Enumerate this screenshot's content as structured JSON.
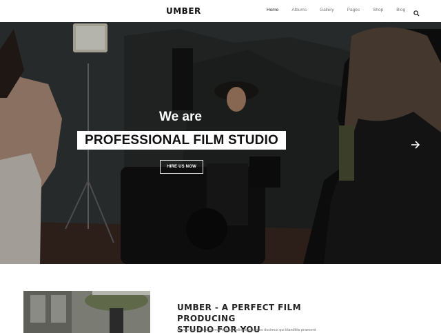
{
  "header": {
    "logo": "UMBER",
    "nav": [
      {
        "label": "Home",
        "active": true
      },
      {
        "label": "Albums",
        "active": false
      },
      {
        "label": "Gallery",
        "active": false
      },
      {
        "label": "Pages",
        "active": false
      },
      {
        "label": "Shop",
        "active": false
      },
      {
        "label": "Blog",
        "active": false
      }
    ],
    "search_icon": "search-icon"
  },
  "hero": {
    "kicker": "We are",
    "title": "PROFESSIONAL FILM STUDIO",
    "button_label": "HIRE US NOW",
    "next_icon": "arrow-right-icon"
  },
  "intro": {
    "title_line1": "UMBER - A PERFECT FILM PRODUCING",
    "title_line2": "STUDIO FOR YOU",
    "text": "At vero eos et accusamus et iusto odio dignissimos ducimus qui blanditiis praesent"
  }
}
